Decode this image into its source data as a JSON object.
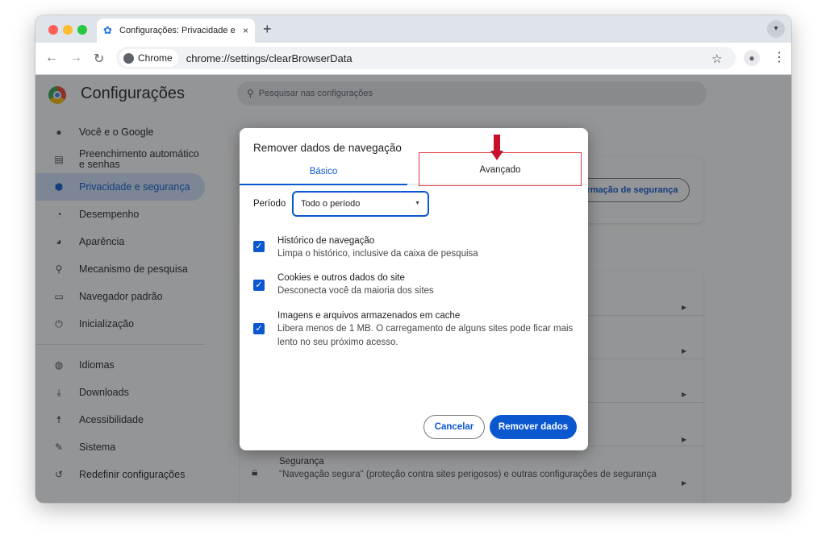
{
  "window": {
    "tab_title": "Configurações: Privacidade e",
    "tab_icon": "gear-icon",
    "new_tab_label": "+",
    "tab_close": "×"
  },
  "toolbar": {
    "chip_label": "Chrome",
    "url": "chrome://settings/clearBrowserData"
  },
  "settings": {
    "title": "Configurações",
    "search_placeholder": "Pesquisar nas configurações",
    "nav": [
      {
        "label": "Você e o Google",
        "icon": "person-icon"
      },
      {
        "label": "Preenchimento automático e senhas",
        "icon": "clipboard-icon"
      },
      {
        "label": "Privacidade e segurança",
        "icon": "shield-icon",
        "active": true
      },
      {
        "label": "Desempenho",
        "icon": "speedometer-icon"
      },
      {
        "label": "Aparência",
        "icon": "palette-icon"
      },
      {
        "label": "Mecanismo de pesquisa",
        "icon": "search-icon"
      },
      {
        "label": "Navegador padrão",
        "icon": "browser-icon"
      },
      {
        "label": "Inicialização",
        "icon": "power-icon"
      },
      {
        "label": "Idiomas",
        "icon": "globe-icon"
      },
      {
        "label": "Downloads",
        "icon": "download-icon"
      },
      {
        "label": "Acessibilidade",
        "icon": "accessibility-icon"
      },
      {
        "label": "Sistema",
        "icon": "wrench-icon"
      },
      {
        "label": "Redefinir configurações",
        "icon": "history-icon"
      }
    ],
    "bg_button_label": "rmação de segurança",
    "security_row": {
      "title": "Segurança",
      "description": "\"Navegação segura\" (proteção contra sites perigosos) e outras configurações de segurança"
    }
  },
  "dialog": {
    "title": "Remover dados de navegação",
    "tab_basic": "Básico",
    "tab_advanced": "Avançado",
    "period_label": "Período",
    "period_value": "Todo o período",
    "items": [
      {
        "title": "Histórico de navegação",
        "description": "Limpa o histórico, inclusive da caixa de pesquisa",
        "checked": true
      },
      {
        "title": "Cookies e outros dados do site",
        "description": "Desconecta você da maioria dos sites",
        "checked": true
      },
      {
        "title": "Imagens e arquivos armazenados em cache",
        "description": "Libera menos de 1 MB. O carregamento de alguns sites pode ficar mais lento no seu próximo acesso.",
        "checked": true
      }
    ],
    "cancel_label": "Cancelar",
    "remove_label": "Remover dados"
  },
  "colors": {
    "accent": "#0b57d0",
    "highlight_border": "#e0393e",
    "arrow": "#c8102e"
  }
}
